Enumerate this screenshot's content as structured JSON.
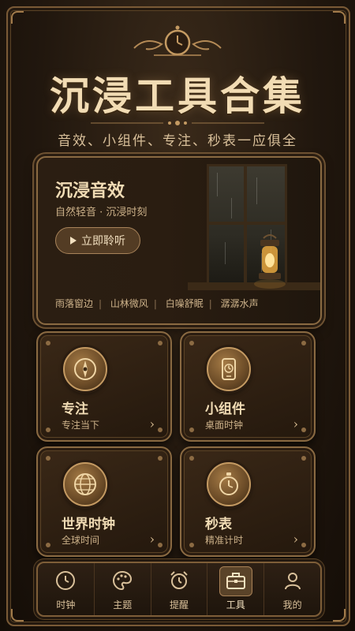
{
  "header": {
    "title": "沉浸工具合集",
    "subtitle": "音效、小组件、专注、秒表一应俱全"
  },
  "hero": {
    "title": "沉浸音效",
    "subtitle": "自然轻音 · 沉浸时刻",
    "button_label": "立即聆听",
    "tags": [
      "雨落窗边",
      "山林微风",
      "白噪舒眠",
      "潺潺水声"
    ]
  },
  "cards": [
    {
      "title": "专注",
      "subtitle": "专注当下",
      "icon": "compass-icon"
    },
    {
      "title": "小组件",
      "subtitle": "桌面时钟",
      "icon": "phone-clock-icon"
    },
    {
      "title": "世界时钟",
      "subtitle": "全球时间",
      "icon": "globe-icon"
    },
    {
      "title": "秒表",
      "subtitle": "精准计时",
      "icon": "stopwatch-icon"
    }
  ],
  "tabbar": {
    "items": [
      {
        "label": "时钟",
        "icon": "clock-icon"
      },
      {
        "label": "主题",
        "icon": "palette-icon"
      },
      {
        "label": "提醒",
        "icon": "alarm-icon"
      },
      {
        "label": "工具",
        "icon": "toolbox-icon",
        "active": true
      },
      {
        "label": "我的",
        "icon": "user-icon"
      }
    ]
  },
  "colors": {
    "accent": "#c49a62",
    "background": "#21170e",
    "text": "#f1dcb5"
  }
}
